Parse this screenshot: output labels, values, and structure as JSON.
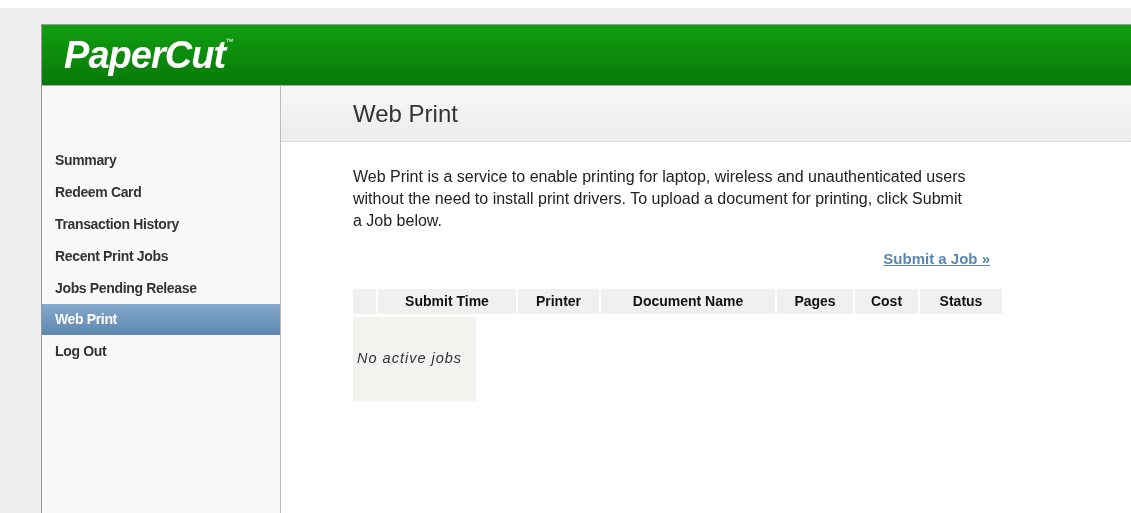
{
  "header": {
    "logo": "PaperCut",
    "trademark": "™"
  },
  "sidebar": {
    "items": [
      {
        "label": "Summary",
        "selected": false
      },
      {
        "label": "Redeem Card",
        "selected": false
      },
      {
        "label": "Transaction History",
        "selected": false
      },
      {
        "label": "Recent Print Jobs",
        "selected": false
      },
      {
        "label": "Jobs Pending Release",
        "selected": false
      },
      {
        "label": "Web Print",
        "selected": true
      },
      {
        "label": "Log Out",
        "selected": false
      }
    ]
  },
  "page": {
    "title": "Web Print",
    "intro": "Web Print is a service to enable printing for laptop, wireless and unauthenticated users without the need to install print drivers. To upload a document for printing, click Submit a Job below.",
    "submit_link": "Submit a Job »"
  },
  "table": {
    "columns": [
      "",
      "Submit Time",
      "Printer",
      "Document Name",
      "Pages",
      "Cost",
      "Status"
    ],
    "empty_message": "No active jobs"
  }
}
